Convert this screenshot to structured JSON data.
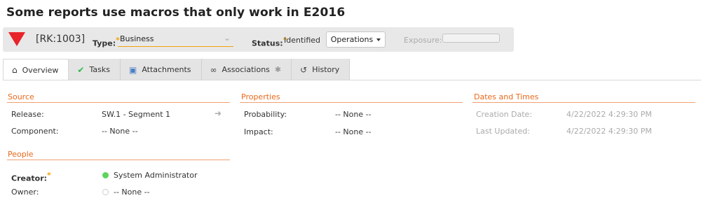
{
  "page": {
    "title": "Some reports use macros that only work in E2016"
  },
  "header": {
    "risk_id": "[RK:1003]",
    "type_label": "Type:",
    "type_value": "Business",
    "status_label": "Status:",
    "status_value": "Identified",
    "operations_label": "Operations",
    "exposure_label": "Exposure:"
  },
  "tabs": [
    {
      "label": "Overview",
      "icon": "home-icon",
      "active": true
    },
    {
      "label": "Tasks",
      "icon": "check-icon"
    },
    {
      "label": "Attachments",
      "icon": "document-icon"
    },
    {
      "label": "Associations",
      "icon": "link-icon"
    },
    {
      "label": "History",
      "icon": "history-icon"
    }
  ],
  "source": {
    "heading": "Source",
    "release_label": "Release:",
    "release_value": "SW.1 - Segment 1",
    "component_label": "Component:",
    "component_value": "-- None --"
  },
  "people": {
    "heading": "People",
    "creator_label": "Creator:",
    "creator_value": "System Administrator",
    "owner_label": "Owner:",
    "owner_value": "-- None --"
  },
  "properties": {
    "heading": "Properties",
    "probability_label": "Probability:",
    "probability_value": "-- None --",
    "impact_label": "Impact:",
    "impact_value": "-- None --"
  },
  "dates": {
    "heading": "Dates and Times",
    "creation_label": "Creation Date:",
    "creation_value": "4/22/2022 4:29:30 PM",
    "updated_label": "Last Updated:",
    "updated_value": "4/22/2022 4:29:30 PM"
  },
  "colors": {
    "accent": "#e8691a",
    "risk": "#e8232a",
    "required": "#f0a30a",
    "online": "#5dd45d"
  }
}
